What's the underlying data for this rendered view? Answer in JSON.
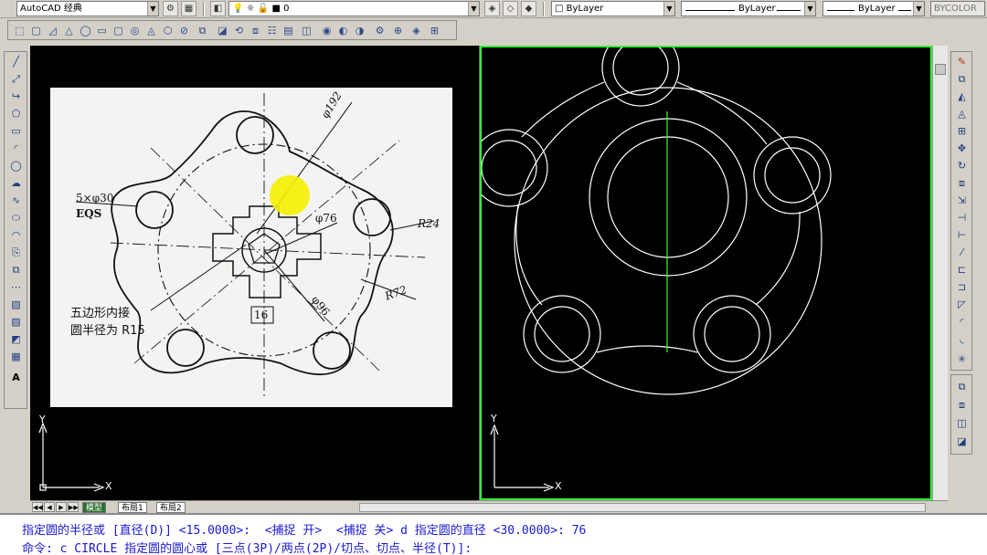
{
  "workspace": {
    "value": "AutoCAD 经典"
  },
  "layer": {
    "value": "0"
  },
  "properties": {
    "color": "ByLayer",
    "linetype": "ByLayer",
    "lineweight": "ByLayer",
    "plotstyle": "BYCOLOR"
  },
  "drawing_image": {
    "labels": {
      "dia192": "φ192",
      "holes": "5×φ30",
      "eqs": "EQS",
      "dia76": "φ76",
      "r24": "R24",
      "r72": "R72",
      "dia96": "φ96",
      "dim16": "16",
      "note1": "五边形内接",
      "note2": "圆半径为 R15"
    }
  },
  "ucs": {
    "x": "X",
    "y": "Y"
  },
  "tabs": {
    "model": "模型",
    "layout1": "布局1",
    "layout2": "布局2"
  },
  "command": {
    "history": "指定圆的半径或 [直径(D)] <15.0000>:  <捕捉 开>  <捕捉 关> d 指定圆的直径 <30.0000>: 76",
    "prompt": "命令: c CIRCLE 指定圆的圆心或 [三点(3P)/两点(2P)/切点、切点、半径(T)]:"
  },
  "colors": {
    "viewport_active": "#33ff33",
    "background": "#000000",
    "geometry": "#ffffff",
    "command_text": "#1a1ad0",
    "highlight": "#f5f000"
  }
}
